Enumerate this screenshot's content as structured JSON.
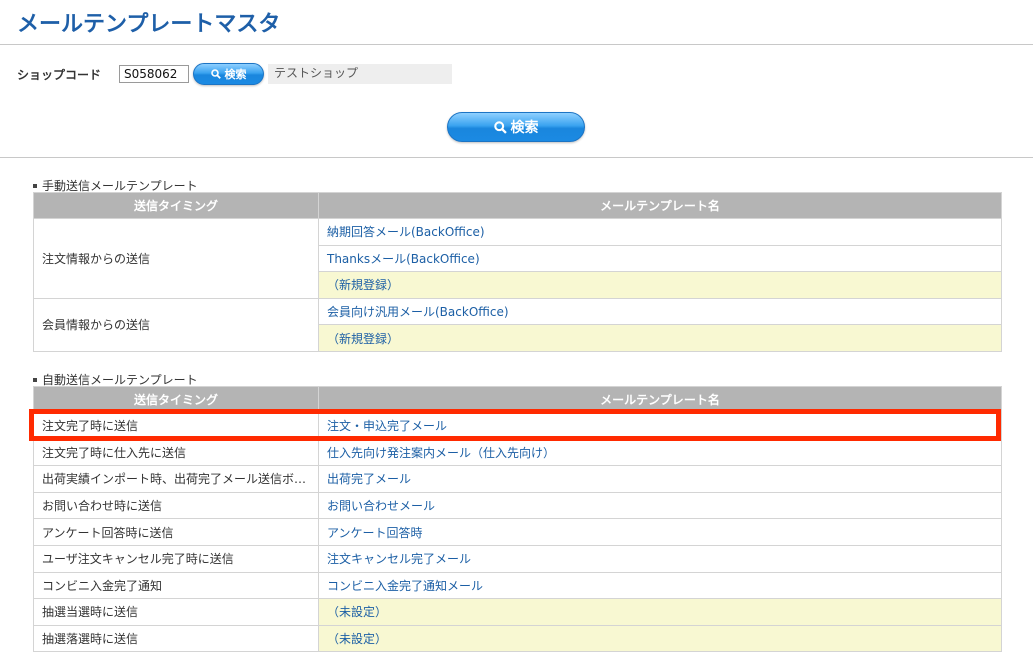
{
  "page": {
    "title": "メールテンプレートマスタ"
  },
  "search": {
    "shop_code_label": "ショップコード",
    "shop_code_value": "S058062",
    "small_button_label": "検索",
    "shop_name": "テストショップ",
    "main_button_label": "検索"
  },
  "manual": {
    "section_label": "手動送信メールテンプレート",
    "headers": {
      "timing": "送信タイミング",
      "name": "メールテンプレート名"
    },
    "groups": [
      {
        "timing": "注文情報からの送信",
        "items": [
          "納期回答メール(BackOffice)",
          "Thanksメール(BackOffice)",
          "（新規登録）"
        ]
      },
      {
        "timing": "会員情報からの送信",
        "items": [
          "会員向け汎用メール(BackOffice)",
          "（新規登録）"
        ]
      }
    ]
  },
  "auto": {
    "section_label": "自動送信メールテンプレート",
    "headers": {
      "timing": "送信タイミング",
      "name": "メールテンプレート名"
    },
    "rows": [
      {
        "timing": "注文完了時に送信",
        "name": "注文・申込完了メール"
      },
      {
        "timing": "注文完了時に仕入先に送信",
        "name": "仕入先向け発注案内メール（仕入先向け）"
      },
      {
        "timing": "出荷実績インポート時、出荷完了メール送信ボ…",
        "name": "出荷完了メール"
      },
      {
        "timing": "お問い合わせ時に送信",
        "name": "お問い合わせメール"
      },
      {
        "timing": "アンケート回答時に送信",
        "name": "アンケート回答時"
      },
      {
        "timing": "ユーザ注文キャンセル完了時に送信",
        "name": "注文キャンセル完了メール"
      },
      {
        "timing": "コンビニ入金完了通知",
        "name": "コンビニ入金完了通知メール"
      },
      {
        "timing": "抽選当選時に送信",
        "name": "（未設定）"
      },
      {
        "timing": "抽選落選時に送信",
        "name": "（未設定）"
      }
    ]
  },
  "colors": {
    "accent": "#1e5fa8",
    "highlight": "#ff2a00",
    "unset_bg": "#f8f8d2",
    "header_bg": "#b4b4b4"
  }
}
